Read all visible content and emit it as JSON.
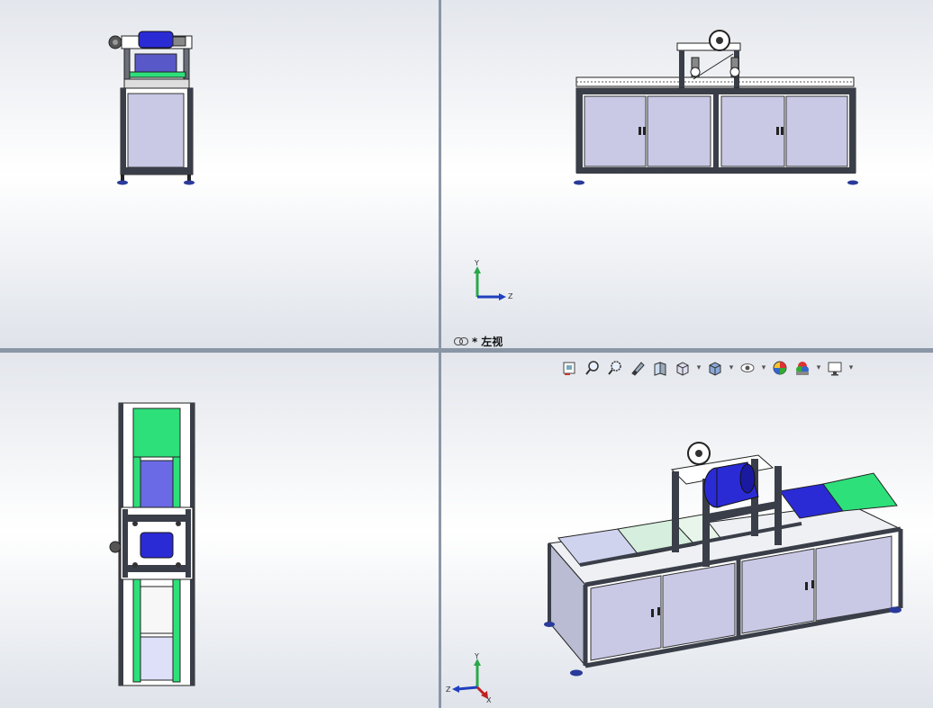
{
  "viewports": {
    "top_right": {
      "label_prefix": "*",
      "label": "左视",
      "triad": {
        "up": "Y",
        "right": "Z"
      }
    },
    "bottom_right": {
      "triad": {
        "up": "Y",
        "left": "Z",
        "front": "X"
      }
    }
  },
  "heads_up_toolbar": [
    {
      "name": "previous-view-icon",
      "dropdown": false
    },
    {
      "name": "zoom-to-fit-icon",
      "dropdown": false
    },
    {
      "name": "zoom-to-area-icon",
      "dropdown": false
    },
    {
      "name": "section-view-icon",
      "dropdown": false
    },
    {
      "name": "dynamic-annotation-views-icon",
      "dropdown": false
    },
    {
      "name": "view-orientation-icon",
      "dropdown": true
    },
    {
      "name": "display-style-icon",
      "dropdown": true
    },
    {
      "name": "hide-show-items-icon",
      "dropdown": true
    },
    {
      "name": "edit-appearance-icon",
      "dropdown": false
    },
    {
      "name": "apply-scene-icon",
      "dropdown": true
    },
    {
      "name": "view-settings-icon",
      "dropdown": true
    }
  ],
  "colors": {
    "roller_blue": "#2b2bd6",
    "belt_green": "#2ee07a",
    "panel_lavender": "#c9c9e6",
    "frame_dark": "#2a2e38",
    "axis_y": "#2aa84a",
    "axis_z": "#1f3fbf",
    "axis_x": "#c02020"
  }
}
